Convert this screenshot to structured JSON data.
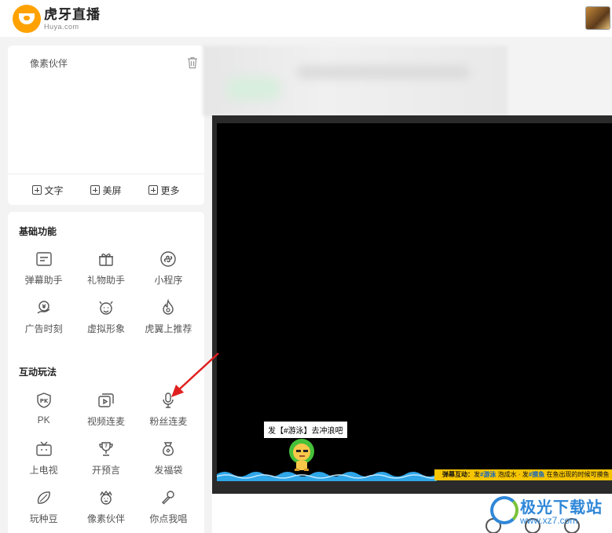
{
  "brand": {
    "name_cn": "虎牙直播",
    "name_en": "Huya.com"
  },
  "sources": {
    "items": [
      {
        "label": "像素伙伴"
      }
    ]
  },
  "add_buttons": [
    {
      "label": "文字"
    },
    {
      "label": "美屏"
    },
    {
      "label": "更多"
    }
  ],
  "sections": {
    "basic": {
      "title": "基础功能",
      "tools": [
        {
          "label": "弹幕助手",
          "icon": "danmaku-icon"
        },
        {
          "label": "礼物助手",
          "icon": "gift-icon"
        },
        {
          "label": "小程序",
          "icon": "mini-program-icon"
        },
        {
          "label": "广告时刻",
          "icon": "ad-money-icon"
        },
        {
          "label": "虚拟形象",
          "icon": "avatar-face-icon"
        },
        {
          "label": "虎翼上推荐",
          "icon": "flame-icon"
        }
      ]
    },
    "interactive": {
      "title": "互动玩法",
      "tools": [
        {
          "label": "PK",
          "icon": "pk-shield-icon"
        },
        {
          "label": "视频连麦",
          "icon": "video-link-icon"
        },
        {
          "label": "粉丝连麦",
          "icon": "microphone-icon"
        },
        {
          "label": "上电视",
          "icon": "tv-icon"
        },
        {
          "label": "开预言",
          "icon": "trophy-question-icon"
        },
        {
          "label": "发福袋",
          "icon": "lucky-bag-icon"
        },
        {
          "label": "玩种豆",
          "icon": "bean-icon"
        },
        {
          "label": "像素伙伴",
          "icon": "pixel-pet-icon"
        },
        {
          "label": "你点我唱",
          "icon": "mic-song-icon"
        }
      ]
    }
  },
  "stage": {
    "bubble_text": "发【#游泳】去冲浪吧",
    "ticker": {
      "prefix": "弹幕互动：",
      "part1": "发",
      "kw1": "#游泳",
      "part2": "泡成水 · 发",
      "kw2": "#摸鱼",
      "part3": "在鱼出现的时候可摸鱼"
    }
  },
  "watermark": {
    "title": "极光下载站",
    "url": "www.xz7.com"
  },
  "colors": {
    "brand_orange": "#ffa200",
    "annotation_red": "#e02020",
    "ticker_yellow": "#f6c400",
    "watermark_blue": "#2f87d8"
  }
}
